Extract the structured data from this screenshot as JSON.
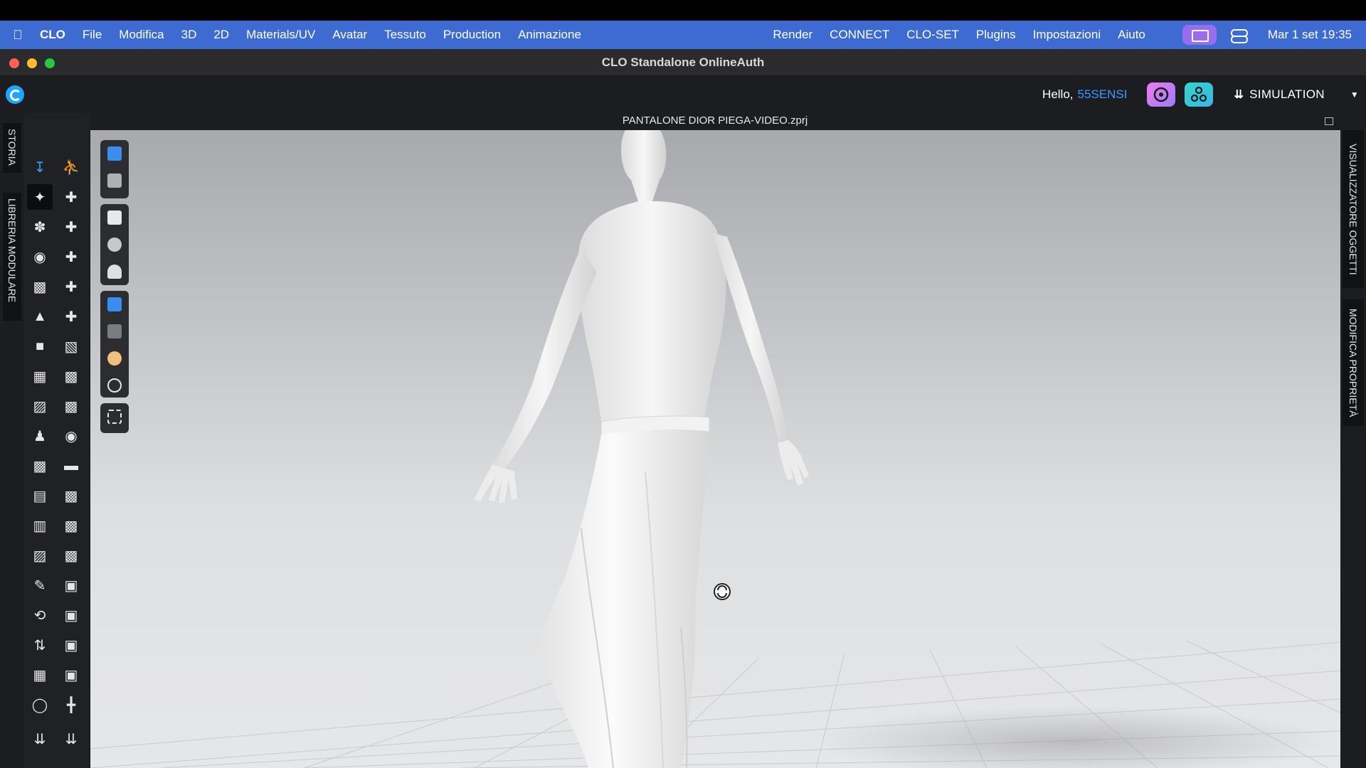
{
  "menubar": {
    "app_name": "CLO",
    "items": [
      "File",
      "Modifica",
      "3D",
      "2D",
      "Materials/UV",
      "Avatar",
      "Tessuto",
      "Production",
      "Animazione"
    ],
    "right_items": [
      "Render",
      "CONNECT",
      "CLO-SET",
      "Plugins",
      "Impostazioni",
      "Aiuto"
    ],
    "clock": "Mar 1 set  19:35"
  },
  "window": {
    "title": "CLO Standalone OnlineAuth"
  },
  "header": {
    "greeting": "Hello,",
    "username": "55SENSI",
    "mode": "SIMULATION"
  },
  "left_tabs": [
    "STORIA",
    "LIBRERIA MODULARE"
  ],
  "right_tabs": [
    "VISUALIZZATORE OGGETTI",
    "MODIFICA PROPRIETÀ"
  ],
  "document": {
    "filename": "PANTALONE DIOR PIEGA-VIDEO.zprj"
  },
  "colors": {
    "menubar": "#3d6bd1",
    "accent": "#1da6ff",
    "username": "#3a9bff",
    "traffic_red": "#fe5f57",
    "traffic_yellow": "#febc2e",
    "traffic_green": "#28c840"
  }
}
